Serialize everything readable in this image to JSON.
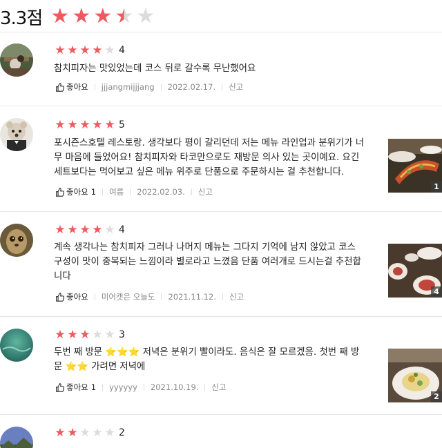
{
  "summary": {
    "score_text": "3.3점",
    "rating": 3.3,
    "star_colors": {
      "on": "#ef5a5f",
      "off": "#dcdcdc"
    }
  },
  "reviews": [
    {
      "rating": 4,
      "rating_label": "4",
      "text": "참치피자는 맛있었는데 코스 뒤로 갈수록 무난했어요",
      "like_label": "좋아요",
      "like_count": "",
      "author": "jjjangmijjjang",
      "date": "2022.02.17.",
      "report_label": "신고",
      "avatar": "cafe-table-photo"
    },
    {
      "rating": 5,
      "rating_label": "5",
      "text": "포시즌스호텔 레스토랑. 생각보다 평이 갈리던데 저는 메뉴 라인업과 분위기가 너\n무 마음에 들었어요! 참치피자와 타코만으로도 재방문 의사 있는 곳이예요. 요긴\n세트보다는 먹어보고 싶은 메뉴 위주로 단품으로 주문하시는 걸 추천합니다.",
      "like_label": "좋아요",
      "like_count": "1",
      "author": "여름",
      "date": "2022.02.03.",
      "report_label": "신고",
      "avatar": "teddy-bear-photo",
      "photo_count": "1"
    },
    {
      "rating": 4,
      "rating_label": "4",
      "text": "계속 생각나는 참치피자 그러나 나머지 메뉴는 그다지 기억에 남지 않았고 코스\n구성이 맛이 중복되는 느낌이라 별로라고 느꼈음 단품 여러개로 드시는걸 추천합\n니다",
      "like_label": "좋아요",
      "like_count": "",
      "author": "미어캣은 오늘도",
      "date": "2021.11.12.",
      "report_label": "신고",
      "avatar": "meerkat-photo",
      "photo_count": "4"
    },
    {
      "rating": 3,
      "rating_label": "3",
      "text_parts": [
        "두번 째 방문 ",
        "⭐⭐⭐",
        " 저녁은 분위기 빨이라도. 음식은 잘 모르겠음.  첫번 째 방",
        "문 ",
        "⭐⭐",
        " 가려면 저녁에"
      ],
      "like_label": "좋아요",
      "like_count": "1",
      "author": "yyyyyy",
      "date": "2021.10.19.",
      "report_label": "신고",
      "avatar": "teal-water-photo",
      "photo_count": "2"
    },
    {
      "rating": 2,
      "rating_label": "2",
      "avatar": "mountain-sky-photo"
    }
  ]
}
